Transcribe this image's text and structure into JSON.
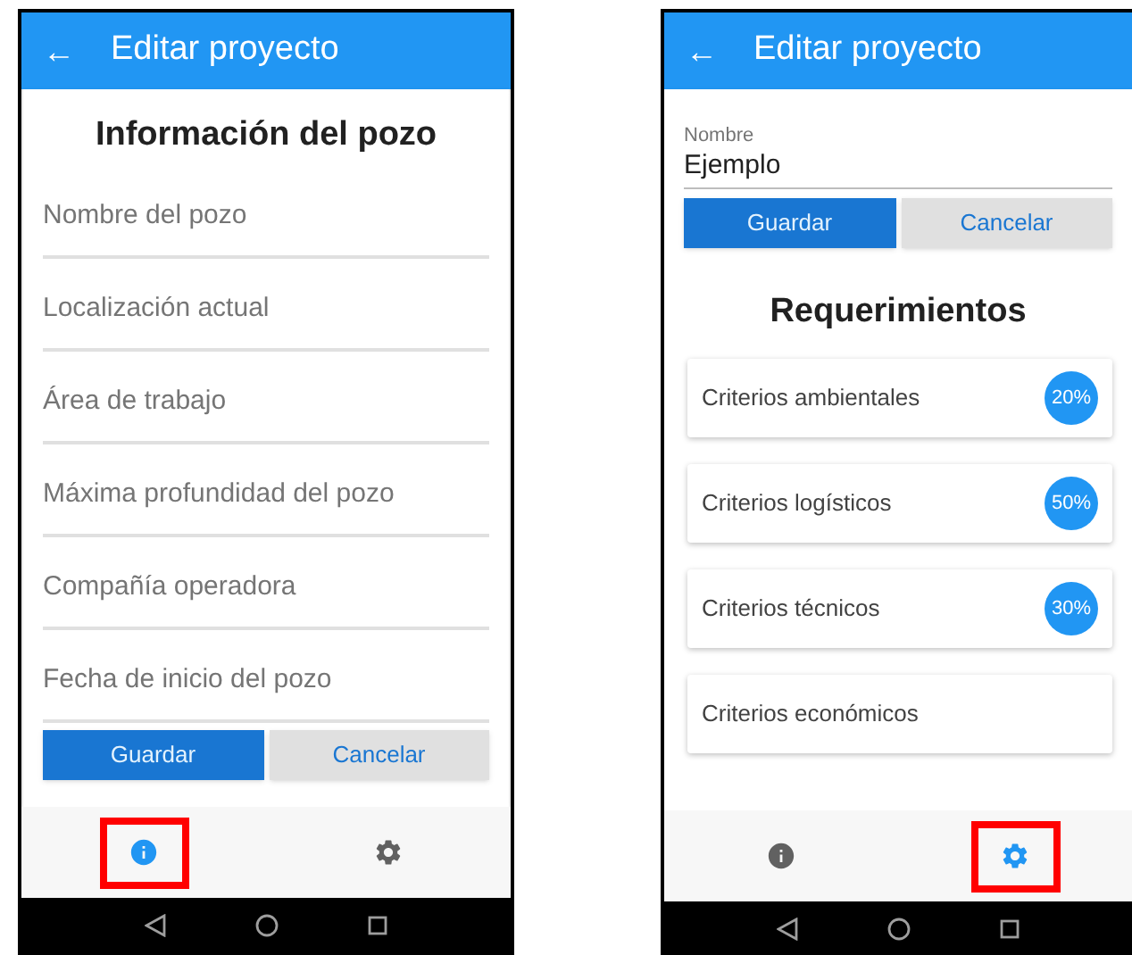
{
  "screens": [
    {
      "kind": "form",
      "header": {
        "back": "←",
        "title": "Editar proyecto"
      },
      "heading": "Información del pozo",
      "fields": [
        {
          "placeholder": "Nombre del pozo"
        },
        {
          "placeholder": "Localización actual"
        },
        {
          "placeholder": "Área de trabajo"
        },
        {
          "placeholder": "Máxima profundidad del pozo"
        },
        {
          "placeholder": "Compañía operadora"
        },
        {
          "placeholder": "Fecha de inicio del pozo"
        }
      ],
      "buttons": [
        {
          "label": "Guardar",
          "kind": "primary"
        },
        {
          "label": "Cancelar",
          "kind": "secondary"
        }
      ],
      "nav": [
        {
          "kind": "info",
          "selected": true,
          "highlighted": true
        },
        {
          "kind": "settings",
          "selected": false,
          "highlighted": false
        }
      ]
    },
    {
      "kind": "requirements",
      "header": {
        "back": "←",
        "title": "Editar proyecto"
      },
      "name_field": {
        "label": "Nombre",
        "value": "Ejemplo"
      },
      "buttons": [
        {
          "label": "Guardar",
          "kind": "primary"
        },
        {
          "label": "Cancelar",
          "kind": "secondary"
        }
      ],
      "heading": "Requerimientos",
      "criteria": [
        {
          "label": "Criterios ambientales",
          "badge": "20%"
        },
        {
          "label": "Criterios logísticos",
          "badge": "50%"
        },
        {
          "label": "Criterios técnicos",
          "badge": "30%"
        },
        {
          "label": "Criterios económicos"
        }
      ],
      "nav": [
        {
          "kind": "info",
          "selected": false,
          "highlighted": false
        },
        {
          "kind": "settings",
          "selected": true,
          "highlighted": true
        }
      ]
    }
  ]
}
